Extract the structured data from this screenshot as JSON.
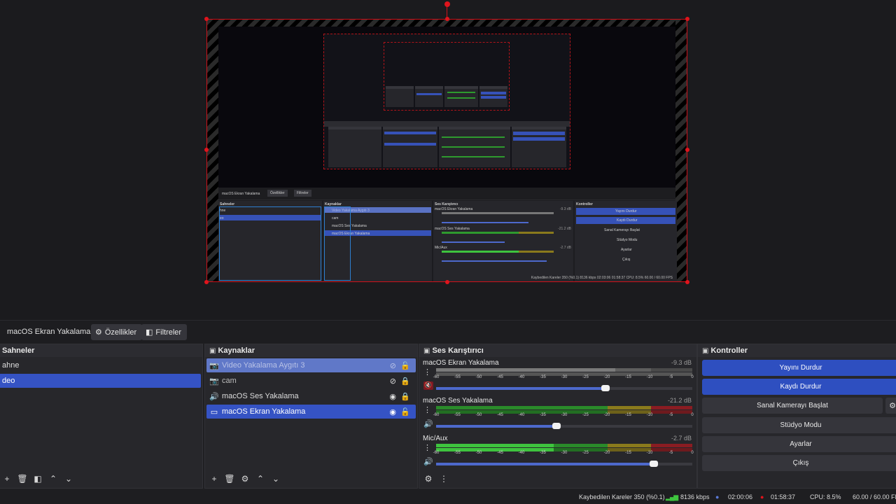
{
  "source_toolbar": {
    "selected_source": "macOS Ekran Yakalama",
    "properties_label": "Özellikler",
    "filters_label": "Filtreler"
  },
  "scenes": {
    "title": "Sahneler",
    "items": [
      {
        "label": "ahne",
        "selected": false
      },
      {
        "label": "deo",
        "selected": true
      }
    ]
  },
  "sources": {
    "title": "Kaynaklar",
    "items": [
      {
        "label": "Video Yakalama Aygıtı 3",
        "icon": "camera-icon",
        "visible": false,
        "locked": false,
        "state": "dimmed"
      },
      {
        "label": "cam",
        "icon": "camera-icon",
        "visible": false,
        "locked": true,
        "state": "normal"
      },
      {
        "label": "macOS Ses Yakalama",
        "icon": "speaker-icon",
        "visible": true,
        "locked": true,
        "state": "normal"
      },
      {
        "label": "macOS Ekran Yakalama",
        "icon": "monitor-icon",
        "visible": true,
        "locked": false,
        "state": "selected"
      }
    ]
  },
  "mixer": {
    "title": "Ses Karıştırıcı",
    "scale": [
      "-60",
      "-55",
      "-50",
      "-45",
      "-40",
      "-35",
      "-30",
      "-25",
      "-20",
      "-15",
      "-10",
      "-5",
      "0"
    ],
    "channels": [
      {
        "name": "macOS Ekran Yakalama",
        "db": "-9.3 dB",
        "fader": 0.66,
        "muted": true
      },
      {
        "name": "macOS Ses Yakalama",
        "db": "-21.2 dB",
        "fader": 0.47,
        "muted": false
      },
      {
        "name": "Mic/Aux",
        "db": "-2.7 dB",
        "fader": 0.85,
        "muted": false
      }
    ]
  },
  "controls": {
    "title": "Kontroller",
    "stop_stream": "Yayını Durdur",
    "stop_record": "Kaydı Durdur",
    "virtual_cam": "Sanal Kamerayı Başlat",
    "studio_mode": "Stüdyo Modu",
    "settings": "Ayarlar",
    "exit": "Çıkış"
  },
  "status": {
    "dropped_frames": "Kaybedilen Kareler 350 (%0.1)",
    "bitrate": "8136 kbps",
    "stream_time": "02:00:06",
    "record_time": "01:58:37",
    "cpu": "CPU: 8.5%",
    "fps": "60.00 / 60.00 FPS"
  },
  "nested_preview": {
    "source_name": "macOS Ekran Yakalama",
    "properties": "Özellikler",
    "filters": "Filtreler",
    "scenes": "Sahneler",
    "sources": "Kaynaklar",
    "mixer": "Ses Karıştırıcı",
    "controls": "Kontroller",
    "src_items": [
      "Video Yakalama Aygıtı 3",
      "cam",
      "macOS Ses Yakalama",
      "macOS Ekran Yakalama"
    ],
    "ctrl_items": [
      "Yayını Durdur",
      "Kaydı Durdur",
      "Sanal Kamerayı Başlat",
      "Stüdyo Modu",
      "Ayarlar",
      "Çıkış"
    ],
    "ch_names": [
      "macOS Ekran Yakalama",
      "macOS Ses Yakalama",
      "Mic/Aux"
    ],
    "ch_db": [
      "-9.3 dB",
      "-21.2 dB",
      "-2.7 dB"
    ],
    "scene_items": [
      "hne",
      "eo"
    ],
    "status": "Kaybedilen Kareler 350 (%0.1)   8136 kbps   02:03:06   01:58:37   CPU: 8.5%   60.00 / 60.00 FPS"
  },
  "colors": {
    "accent": "#3553c4",
    "selection_red": "#d0121a",
    "meter_green": "#2e9a2e",
    "meter_yellow": "#8a7a1c",
    "meter_red": "#8a1c22"
  }
}
